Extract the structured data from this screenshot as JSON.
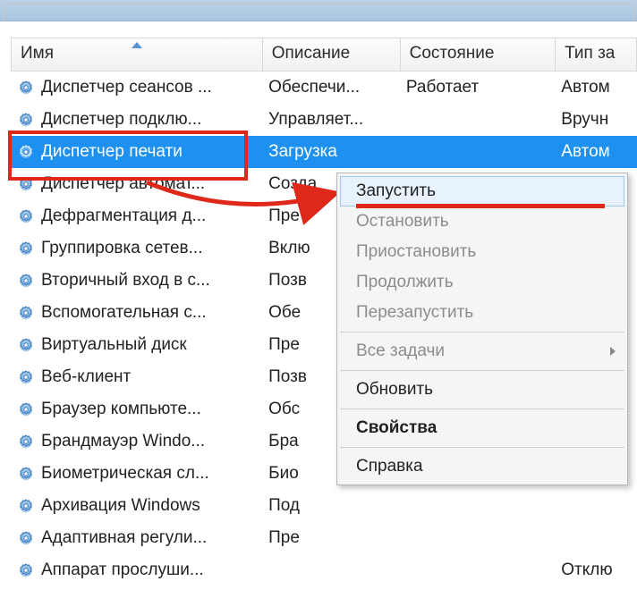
{
  "columns": {
    "name": "Имя",
    "description": "Описание",
    "state": "Состояние",
    "type": "Тип за"
  },
  "rows": [
    {
      "name": "Диспетчер сеансов ...",
      "desc": "Обеспечи...",
      "state": "Работает",
      "type": "Автом"
    },
    {
      "name": "Диспетчер подклю...",
      "desc": "Управляет...",
      "state": "",
      "type": "Вручн"
    },
    {
      "name": "Диспетчер печати",
      "desc": "Загрузка",
      "state": "",
      "type": "Автом"
    },
    {
      "name": "Диспетчер автомат...",
      "desc": "Созда",
      "state": "",
      "type": ""
    },
    {
      "name": "Дефрагментация д...",
      "desc": "Пре",
      "state": "",
      "type": ""
    },
    {
      "name": "Группировка сетев...",
      "desc": "Вклю",
      "state": "",
      "type": ""
    },
    {
      "name": "Вторичный вход в с...",
      "desc": "Позв",
      "state": "",
      "type": ""
    },
    {
      "name": "Вспомогательная с...",
      "desc": "Обе",
      "state": "",
      "type": ""
    },
    {
      "name": "Виртуальный диск",
      "desc": "Пре",
      "state": "",
      "type": ""
    },
    {
      "name": "Веб-клиент",
      "desc": "Позв",
      "state": "",
      "type": ""
    },
    {
      "name": "Браузер компьюте...",
      "desc": "Обс",
      "state": "",
      "type": ""
    },
    {
      "name": "Брандмауэр Windo...",
      "desc": "Бра",
      "state": "",
      "type": ""
    },
    {
      "name": "Биометрическая сл...",
      "desc": "Био",
      "state": "",
      "type": ""
    },
    {
      "name": "Архивация Windows",
      "desc": "Под",
      "state": "",
      "type": ""
    },
    {
      "name": "Адаптивная регули...",
      "desc": "Пре",
      "state": "",
      "type": ""
    },
    {
      "name": "Аппарат прослуши...",
      "desc": "",
      "state": "",
      "type": "Отклю"
    }
  ],
  "selected_index": 2,
  "menu": {
    "start": "Запустить",
    "stop": "Остановить",
    "pause": "Приостановить",
    "continue": "Продолжить",
    "restart": "Перезапустить",
    "all_tasks": "Все задачи",
    "refresh": "Обновить",
    "properties": "Свойства",
    "help": "Справка"
  }
}
